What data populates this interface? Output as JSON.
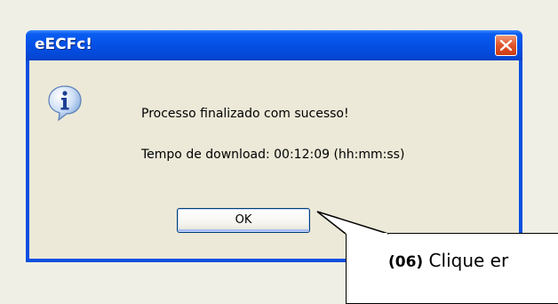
{
  "dialog": {
    "title": "eECFc!",
    "icon": "info-icon",
    "message_line1": "Processo finalizado com sucesso!",
    "message_line2": "Tempo de download: 00:12:09 (hh:mm:ss)",
    "ok_label": "OK"
  },
  "callout": {
    "step": "(06)",
    "text": " Clique er"
  },
  "colors": {
    "title_bar": "#0550e6",
    "client_bg": "#ece9d8",
    "close_button": "#e2582e",
    "desktop_bg": "#f0efe6"
  }
}
